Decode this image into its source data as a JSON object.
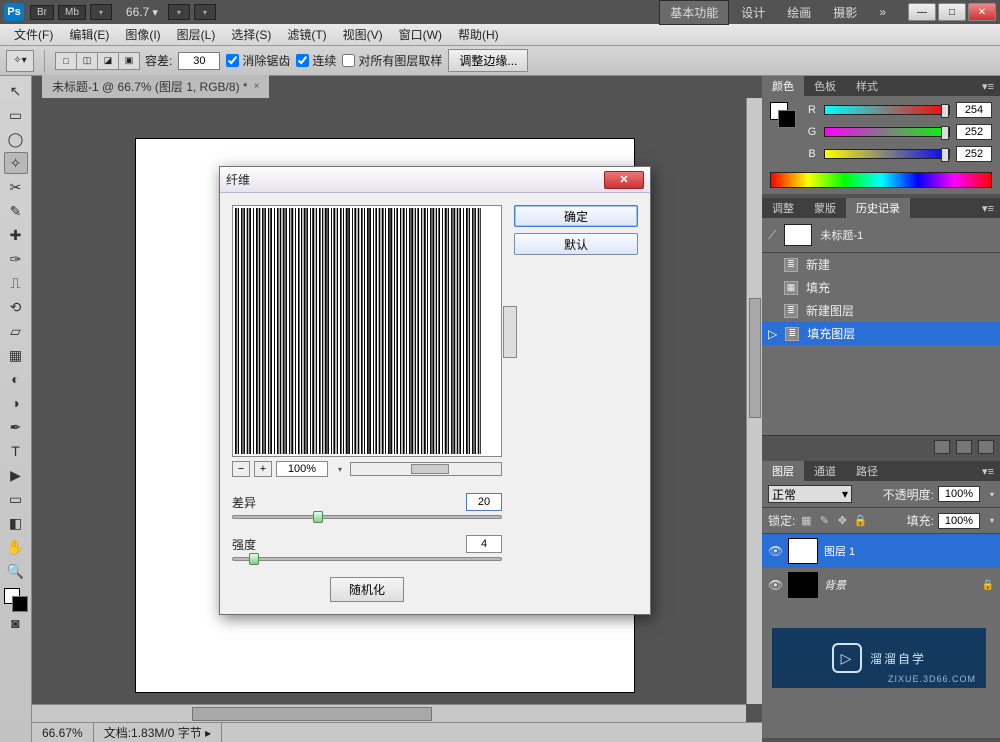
{
  "workspace": {
    "chips": [
      "Br",
      "Mb"
    ],
    "zoom_display": "66.7",
    "tabs": [
      "基本功能",
      "设计",
      "绘画",
      "摄影"
    ],
    "more": "»",
    "active_tab": 0
  },
  "menubar": [
    "文件(F)",
    "编辑(E)",
    "图像(I)",
    "图层(L)",
    "选择(S)",
    "滤镜(T)",
    "视图(V)",
    "窗口(W)",
    "帮助(H)"
  ],
  "options": {
    "tolerance_label": "容差:",
    "tolerance_value": "30",
    "antialias": "消除锯齿",
    "contiguous": "连续",
    "all_layers": "对所有图层取样",
    "refine_edge": "调整边缘..."
  },
  "document": {
    "tab_title": "未标题-1 @ 66.7% (图层 1, RGB/8) *",
    "status_zoom": "66.67%",
    "status_doc": "文档:1.83M/0 字节"
  },
  "tools": [
    "↖",
    "▭",
    "◯",
    "✂",
    "▦",
    "▧",
    "✎",
    "✑",
    "⌗",
    "◐",
    "▤",
    "⟲",
    "T",
    "▶",
    "◧",
    "✋",
    "🔍"
  ],
  "color_panel": {
    "tabs": [
      "颜色",
      "色板",
      "样式"
    ],
    "labels": {
      "r": "R",
      "g": "G",
      "b": "B"
    },
    "r": "254",
    "g": "252",
    "b": "252"
  },
  "history_panel": {
    "tabs": [
      "调整",
      "蒙版",
      "历史记录"
    ],
    "doc_name": "未标题-1",
    "items": [
      {
        "label": "新建",
        "sel": false
      },
      {
        "label": "填充",
        "sel": false
      },
      {
        "label": "新建图层",
        "sel": false
      },
      {
        "label": "填充图层",
        "sel": true
      }
    ]
  },
  "layers_panel": {
    "tabs": [
      "图层",
      "通道",
      "路径"
    ],
    "blend_mode": "正常",
    "opacity_label": "不透明度:",
    "opacity": "100%",
    "lock_label": "锁定:",
    "fill_label": "填充:",
    "fill": "100%",
    "layers": [
      {
        "name": "图层 1",
        "sel": true,
        "black": false,
        "locked": false
      },
      {
        "name": "背景",
        "sel": false,
        "black": true,
        "locked": true
      }
    ]
  },
  "dialog": {
    "title": "纤维",
    "ok": "确定",
    "default": "默认",
    "zoom": "100%",
    "variance_label": "差异",
    "variance_value": "20",
    "strength_label": "强度",
    "strength_value": "4",
    "randomize": "随机化"
  },
  "watermark": {
    "text": "溜溜自学",
    "sub": "ZIXUE.3D66.COM"
  }
}
